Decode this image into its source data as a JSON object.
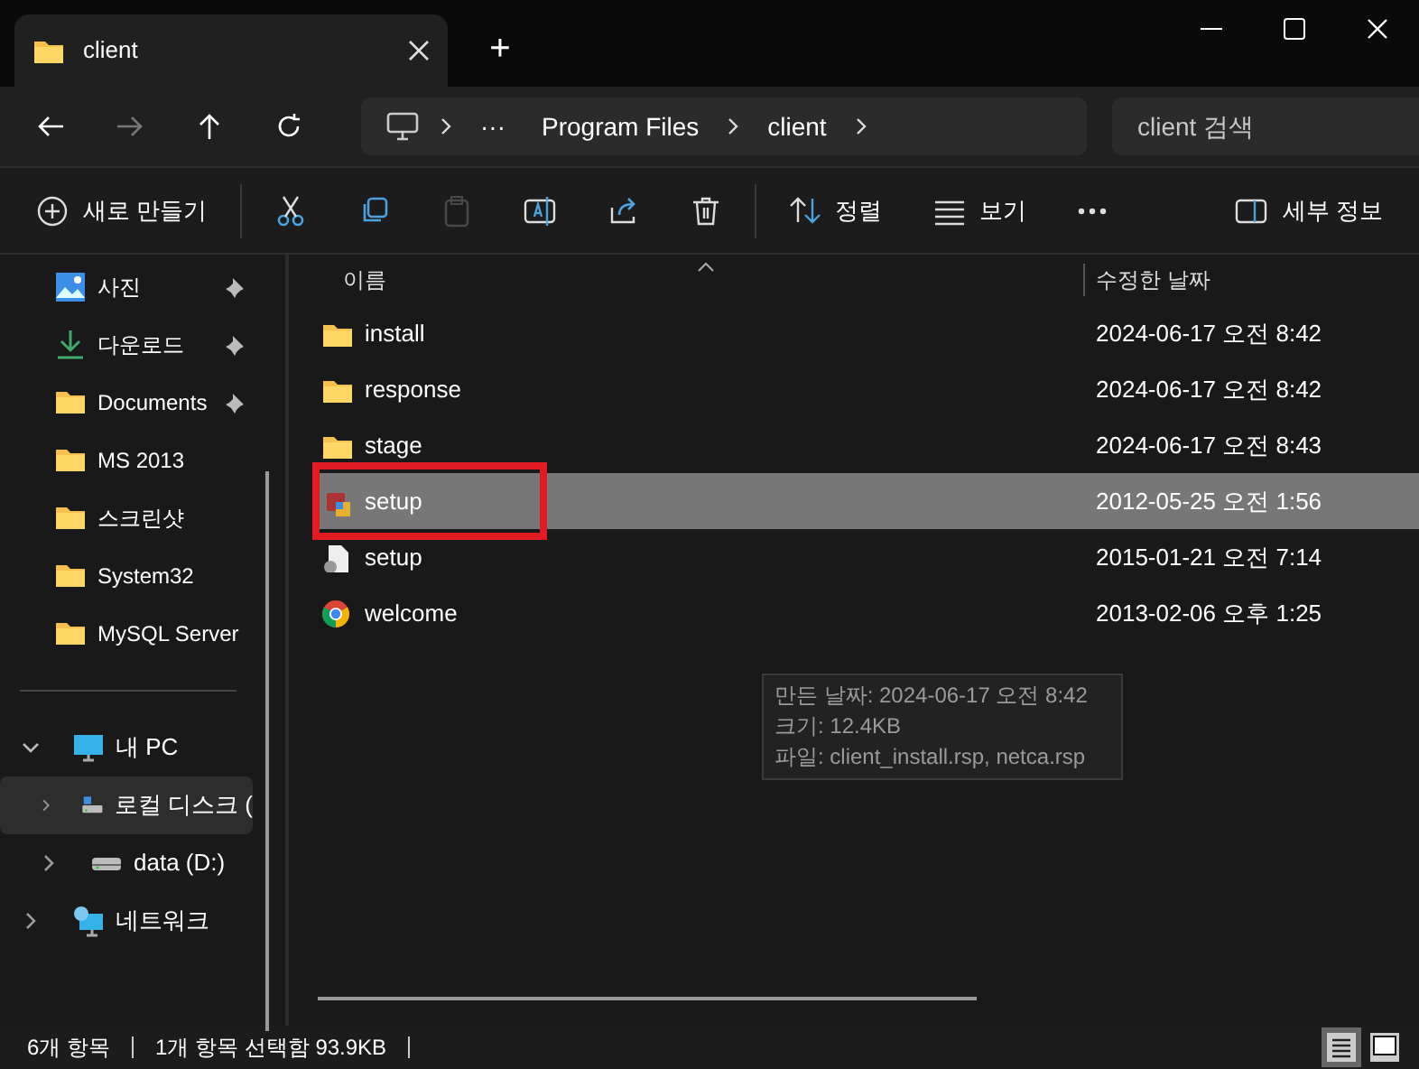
{
  "tabs": [
    {
      "label": "client",
      "selected": true
    }
  ],
  "new_tab": "+",
  "address": {
    "overflow": "···",
    "crumbs": [
      "Program Files",
      "client"
    ]
  },
  "search": {
    "placeholder": "client 검색"
  },
  "toolbar": [
    {
      "kind": "plus",
      "label": "새로 만들기",
      "disabled": false
    },
    {
      "kind": "cut",
      "disabled": false
    },
    {
      "kind": "copy",
      "disabled": false
    },
    {
      "kind": "paste",
      "disabled": true
    },
    {
      "kind": "rename",
      "disabled": false
    },
    {
      "kind": "share",
      "disabled": false
    },
    {
      "kind": "delete",
      "disabled": false
    },
    {
      "kind": "sort",
      "label": "정렬",
      "disabled": false
    },
    {
      "kind": "view",
      "label": "보기",
      "disabled": false
    },
    {
      "kind": "more",
      "disabled": false
    },
    {
      "kind": "details",
      "label": "세부 정보",
      "disabled": false
    }
  ],
  "sidebar": {
    "quick": [
      {
        "label": "사진",
        "kind": "picture",
        "pinned": true
      },
      {
        "label": "다운로드",
        "kind": "download",
        "pinned": true
      },
      {
        "label": "Documents",
        "kind": "folder",
        "pinned": true
      },
      {
        "label": "MS 2013",
        "kind": "folder",
        "pinned": false
      },
      {
        "label": "스크린샷",
        "kind": "folder",
        "pinned": false
      },
      {
        "label": "System32",
        "kind": "folder",
        "pinned": false
      },
      {
        "label": "MySQL Server",
        "kind": "folder",
        "pinned": false
      }
    ],
    "tree": [
      {
        "label": "내 PC",
        "kind": "pc",
        "expanded": true,
        "selected": false,
        "children": [
          {
            "label": "로컬 디스크 (",
            "kind": "systemdrive",
            "expanded": false,
            "selected": true
          },
          {
            "label": "data (D:)",
            "kind": "drive",
            "expanded": false,
            "selected": false
          }
        ]
      },
      {
        "label": "네트워크",
        "kind": "network",
        "expanded": false,
        "selected": false
      }
    ]
  },
  "table": {
    "columns": [
      {
        "label": "이름",
        "sorted": true
      },
      {
        "label": "수정한 날짜",
        "sorted": false
      }
    ],
    "rows": [
      {
        "name": "install",
        "kind": "folder",
        "modified": "2024-06-17 오전 8:42",
        "selected": false,
        "highlighted": false
      },
      {
        "name": "response",
        "kind": "folder",
        "modified": "2024-06-17 오전 8:42",
        "selected": false,
        "highlighted": false
      },
      {
        "name": "stage",
        "kind": "folder",
        "modified": "2024-06-17 오전 8:43",
        "selected": false,
        "highlighted": false
      },
      {
        "name": "setup",
        "kind": "installer",
        "modified": "2012-05-25 오전 1:56",
        "selected": true,
        "highlighted": true
      },
      {
        "name": "setup",
        "kind": "script",
        "modified": "2015-01-21 오전 7:14",
        "selected": false,
        "highlighted": false
      },
      {
        "name": "welcome",
        "kind": "browser",
        "modified": "2013-02-06 오후 1:25",
        "selected": false,
        "highlighted": false
      }
    ]
  },
  "tooltip": [
    "만든 날짜: 2024-06-17 오전 8:42",
    "크기: 12.4KB",
    "파일: client_install.rsp, netca.rsp"
  ],
  "status_bar": {
    "items": [
      "6개 항목",
      "1개 항목 선택함 93.9KB"
    ],
    "views": [
      {
        "kind": "details",
        "selected": true
      },
      {
        "kind": "tiles",
        "selected": false
      }
    ]
  }
}
